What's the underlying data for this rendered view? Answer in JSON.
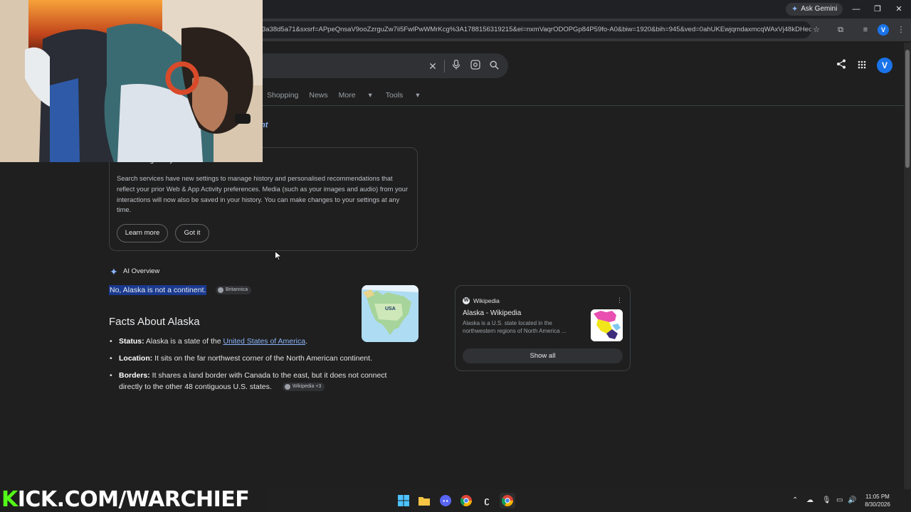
{
  "browser": {
    "gemini_label": "Ask Gemini",
    "url": "3a38d5a71&sxsrf=APpeQnsaV9ooZzrguZw7ii5FwlPwWMrKcg%3A1788156319215&ei=nxmVaqrODOPGp84P59fo-A0&biw=1920&bih=945&ved=0ahUKEwjqmdaxmcqWAxVj48kDHec...",
    "profile_initial": "V"
  },
  "search": {
    "tabs": [
      "Shopping",
      "News",
      "More"
    ],
    "tools_label": "Tools",
    "account_initial": "V"
  },
  "page": {
    "partial_heading": "nt",
    "notice": {
      "title": "New settings for your Search services",
      "body": "Search services have new settings to manage history and personalised recommendations that reflect your prior Web & App Activity preferences. Media (such as your images and audio) from your interactions will now also be saved in your history. You can make changes to your settings at any time.",
      "learn_more": "Learn more",
      "got_it": "Got it"
    },
    "ai_overview": {
      "label": "AI Overview",
      "answer": "No, Alaska is not a continent.",
      "answer_source": "Britannica",
      "map_label": "USA",
      "facts_heading": "Facts About Alaska",
      "facts": [
        {
          "term": "Status:",
          "text_before": " Alaska is a state of the ",
          "link": "United States of America",
          "text_after": "."
        },
        {
          "term": "Location:",
          "text": " It sits on the far northwest corner of the North American continent."
        },
        {
          "term": "Borders:",
          "text": " It shares a land border with Canada to the east, but it does not connect directly to the other 48 contiguous U.S. states.",
          "source": "Wikipedia +3"
        }
      ]
    },
    "wikipedia_card": {
      "source": "Wikipedia",
      "title": "Alaska - Wikipedia",
      "snippet": "Alaska is a U.S. state located in the northwestern regions of North America ...",
      "show_all": "Show all"
    }
  },
  "stream": {
    "banner_k": "K",
    "banner_rest": "ICK.COM/WARCHIEF"
  },
  "taskbar": {
    "time": "11:05 PM",
    "date": "8/30/2026"
  }
}
